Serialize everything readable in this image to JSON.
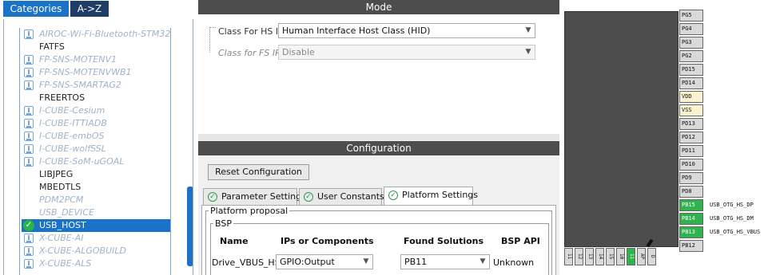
{
  "left": {
    "tab_categories": "Categories",
    "tab_az": "A->Z",
    "items": [
      {
        "label": "AIROC-Wi-Fi-Bluetooth-STM32",
        "style": "dim",
        "icon": "download-icon"
      },
      {
        "label": "FATFS",
        "style": "norm",
        "icon": ""
      },
      {
        "label": "FP-SNS-MOTENV1",
        "style": "dim",
        "icon": "download-icon"
      },
      {
        "label": "FP-SNS-MOTENVWB1",
        "style": "dim",
        "icon": "download-icon"
      },
      {
        "label": "FP-SNS-SMARTAG2",
        "style": "dim",
        "icon": "download-icon"
      },
      {
        "label": "FREERTOS",
        "style": "norm",
        "icon": ""
      },
      {
        "label": "I-CUBE-Cesium",
        "style": "dim",
        "icon": "download-icon"
      },
      {
        "label": "I-CUBE-ITTIADB",
        "style": "dim",
        "icon": "download-icon"
      },
      {
        "label": "I-CUBE-embOS",
        "style": "dim",
        "icon": "download-icon"
      },
      {
        "label": "I-CUBE-wolfSSL",
        "style": "dim",
        "icon": "download-icon"
      },
      {
        "label": "I-CUBE-SoM-uGOAL",
        "style": "dim",
        "icon": "download-icon"
      },
      {
        "label": "LIBJPEG",
        "style": "norm",
        "icon": ""
      },
      {
        "label": "MBEDTLS",
        "style": "norm",
        "icon": ""
      },
      {
        "label": "PDM2PCM",
        "style": "dim",
        "icon": ""
      },
      {
        "label": "USB_DEVICE",
        "style": "dim",
        "icon": ""
      },
      {
        "label": "USB_HOST",
        "style": "sel",
        "icon": "check-icon"
      },
      {
        "label": "X-CUBE-AI",
        "style": "dim",
        "icon": "download-icon"
      },
      {
        "label": "X-CUBE-ALGOBUILD",
        "style": "dim",
        "icon": "download-icon"
      },
      {
        "label": "X-CUBE-ALS",
        "style": "dim",
        "icon": "download-icon"
      }
    ]
  },
  "mode": {
    "header": "Mode",
    "hs_label": "Class For HS IP",
    "hs_value": "Human Interface Host Class (HID)",
    "fs_label": "Class for FS IP",
    "fs_value": "Disable"
  },
  "configuration": {
    "header": "Configuration",
    "reset_button": "Reset Configuration",
    "tabs": [
      "Parameter Settings",
      "User Constants",
      "Platform Settings"
    ],
    "active_tab": "Platform Settings",
    "group_label": "Platform proposal",
    "subgroup_label": "BSP",
    "columns": [
      "Name",
      "IPs or Components",
      "Found Solutions",
      "BSP API"
    ],
    "row": {
      "name": "Drive_VBUS_HS",
      "ip": "GPIO:Output",
      "solution": "PB11",
      "api": "Unknown"
    }
  },
  "chip": {
    "pins": [
      {
        "label": "PG5",
        "kind": "normal"
      },
      {
        "label": "PG4",
        "kind": "normal"
      },
      {
        "label": "PG3",
        "kind": "normal"
      },
      {
        "label": "PG2",
        "kind": "normal"
      },
      {
        "label": "PD15",
        "kind": "normal"
      },
      {
        "label": "PD14",
        "kind": "normal"
      },
      {
        "label": "VDD",
        "kind": "power"
      },
      {
        "label": "VSS",
        "kind": "power"
      },
      {
        "label": "PD13",
        "kind": "normal"
      },
      {
        "label": "PD12",
        "kind": "normal"
      },
      {
        "label": "PD11",
        "kind": "normal"
      },
      {
        "label": "PD10",
        "kind": "normal"
      },
      {
        "label": "PD9",
        "kind": "normal"
      },
      {
        "label": "PD8",
        "kind": "normal"
      },
      {
        "label": "PB15",
        "kind": "green",
        "signal": "USB_OTG_HS_DP"
      },
      {
        "label": "PB14",
        "kind": "green",
        "signal": "USB_OTG_HS_DM"
      },
      {
        "label": "PB13",
        "kind": "green",
        "signal": "USB_OTG_HS_VBUS"
      },
      {
        "label": "PB12",
        "kind": "normal"
      }
    ],
    "bottom_pins": [
      {
        "label": "11",
        "kind": "normal"
      },
      {
        "label": "12",
        "kind": "normal"
      },
      {
        "label": "13",
        "kind": "normal"
      },
      {
        "label": "14",
        "kind": "normal"
      },
      {
        "label": "15",
        "kind": "normal"
      },
      {
        "label": "10",
        "kind": "normal"
      },
      {
        "label": "11",
        "kind": "green"
      },
      {
        "label": "AP",
        "kind": "normal"
      },
      {
        "label": "D",
        "kind": "normal"
      }
    ]
  }
}
